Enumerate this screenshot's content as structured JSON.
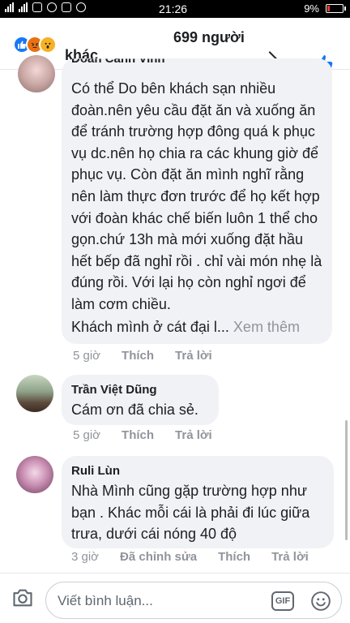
{
  "status_bar": {
    "time": "21:26",
    "battery": "9%"
  },
  "reactions": {
    "count_label": "699 người",
    "other_label": "khác",
    "icons": [
      "like-icon",
      "angry-icon",
      "wow-icon"
    ],
    "like_color": "#1877f2"
  },
  "comments": [
    {
      "author": "Đoàn Cảnh Vinh",
      "text": "Có thể  Do bên khách sạn nhiều đoàn.nên yêu cầu đặt ăn và xuống ăn để tránh trường hợp đông quá k phục vụ dc.nên họ chia ra các khung giờ để phục vụ. Còn đặt ăn mình nghĩ rằng nên làm thực đơn trước để họ kết hợp với đoàn khác chế biến luôn 1 thể cho gọn.chứ 13h mà mới xuống đặt hầu hết bếp đã nghỉ rồi . chỉ vài món nhẹ là đúng rồi. Với lại họ còn nghỉ ngơi để làm cơm chiều.",
      "tail": "Khách mình ở cát đại l...",
      "see_more": "Xem thêm",
      "time": "5 giờ",
      "like": "Thích",
      "reply": "Trả lời"
    },
    {
      "author": "Trần Việt Dũng",
      "text": "Cám ơn đã chia sẻ.",
      "time": "5 giờ",
      "like": "Thích",
      "reply": "Trả lời"
    },
    {
      "author": "Ruli Lùn",
      "text": "Nhà Mình cũng gặp trường hợp như bạn . Khác mỗi cái là phải đi lúc giữa trưa, dưới cái nóng 40 độ",
      "time": "3 giờ",
      "edited": "Đã chỉnh sửa",
      "like": "Thích",
      "reply": "Trả lời"
    }
  ],
  "composer": {
    "placeholder": "Viết bình luận...",
    "gif_label": "GIF",
    "icons": [
      "camera-icon",
      "gif-icon",
      "emoji-icon"
    ]
  }
}
